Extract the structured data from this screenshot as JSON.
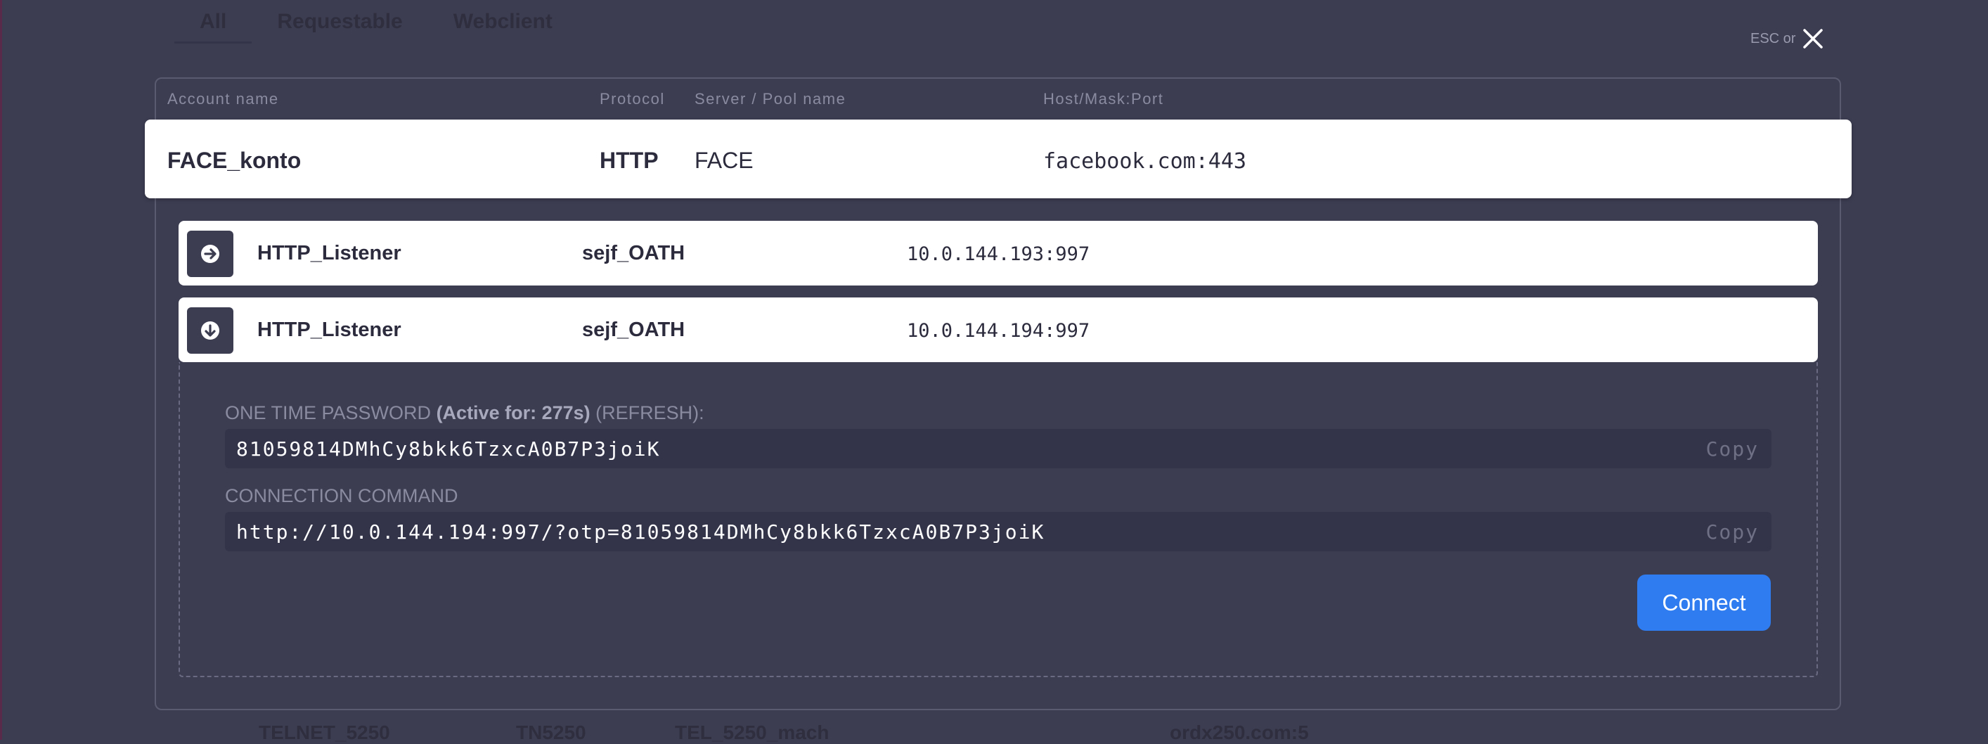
{
  "background": {
    "tabs": [
      "All",
      "Requestable",
      "Webclient"
    ],
    "row": [
      "TELNET_5250",
      "TN5250",
      "TEL_5250_mach",
      "ordx250.com:5"
    ]
  },
  "close": {
    "esc_text": "ESC or",
    "icon": "close-icon"
  },
  "table": {
    "headers": {
      "account": "Account name",
      "protocol": "Protocol",
      "server": "Server / Pool name",
      "host": "Host/Mask:Port"
    }
  },
  "account": {
    "name": "FACE_konto",
    "protocol": "HTTP",
    "server": "FACE",
    "host": "facebook.com:443"
  },
  "pools": [
    {
      "icon": "arrow-right-circle-icon",
      "name": "HTTP_Listener",
      "server": "sejf_OATH",
      "host": "10.0.144.193:997"
    },
    {
      "icon": "arrow-down-circle-icon",
      "name": "HTTP_Listener",
      "server": "sejf_OATH",
      "host": "10.0.144.194:997"
    }
  ],
  "details": {
    "otp_label": "ONE TIME PASSWORD",
    "otp_active": "(Active for: 277s)",
    "otp_refresh": "(REFRESH):",
    "otp_value": "81059814DMhCy8bkk6TzxcA0B7P3joiK",
    "cmd_label": "CONNECTION COMMAND",
    "cmd_value": "http://10.0.144.194:997/?otp=81059814DMhCy8bkk6TzxcA0B7P3joiK",
    "copy_label": "Copy",
    "connect_label": "Connect"
  },
  "colors": {
    "background": "#3d3d52",
    "accent": "#2f7cf0",
    "card": "#ffffff"
  }
}
